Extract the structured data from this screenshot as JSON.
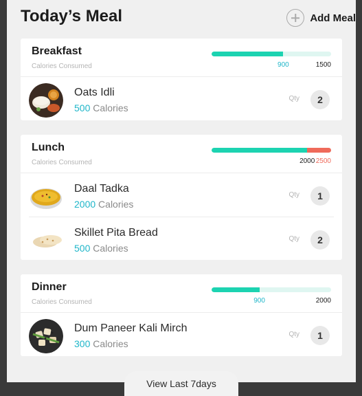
{
  "header": {
    "title": "Today’s Meal",
    "add_label": "Add Meal",
    "add_icon": "plus-circle-icon"
  },
  "meals": [
    {
      "name": "Breakfast",
      "subtitle": "Calories Consumed",
      "consumed": "900",
      "target": "1500",
      "progress_fraction": 0.6,
      "over_target": false,
      "items": [
        {
          "name": "Oats Idli",
          "calories": "500",
          "calories_unit": "Calories",
          "qty_label": "Qty",
          "qty": "2",
          "icon": "oats-idli-food-image"
        }
      ]
    },
    {
      "name": "Lunch",
      "subtitle": "Calories Consumed",
      "consumed": "2000",
      "target": "2500",
      "progress_fraction": 0.8,
      "over_target": true,
      "items": [
        {
          "name": "Daal Tadka",
          "calories": "2000",
          "calories_unit": "Calories",
          "qty_label": "Qty",
          "qty": "1",
          "icon": "daal-tadka-food-image"
        },
        {
          "name": "Skillet Pita Bread",
          "calories": "500",
          "calories_unit": "Calories",
          "qty_label": "Qty",
          "qty": "2",
          "icon": "pita-bread-food-image"
        }
      ]
    },
    {
      "name": "Dinner",
      "subtitle": "Calories Consumed",
      "consumed": "900",
      "target": "2000",
      "progress_fraction": 0.4,
      "over_target": false,
      "items": [
        {
          "name": "Dum Paneer Kali Mirch",
          "calories": "300",
          "calories_unit": "Calories",
          "qty_label": "Qty",
          "qty": "1",
          "icon": "dum-paneer-food-image"
        }
      ]
    }
  ],
  "footer": {
    "view_label": "View Last 7days"
  },
  "colors": {
    "accent": "#1cd3b1",
    "accent_text": "#1fb6c9",
    "over": "#ef6a5a",
    "track": "#dff6f1"
  }
}
